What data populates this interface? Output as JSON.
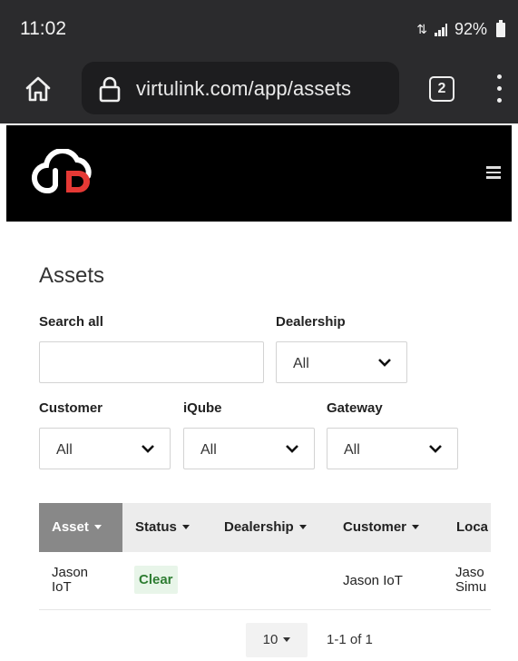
{
  "statusbar": {
    "time": "11:02",
    "battery": "92%"
  },
  "browser": {
    "url": "virtulink.com/app/assets",
    "tab_count": "2"
  },
  "page": {
    "title": "Assets"
  },
  "filters": {
    "search_label": "Search all",
    "search_value": "",
    "dealership_label": "Dealership",
    "dealership_value": "All",
    "customer_label": "Customer",
    "customer_value": "All",
    "iqube_label": "iQube",
    "iqube_value": "All",
    "gateway_label": "Gateway",
    "gateway_value": "All"
  },
  "table": {
    "columns": [
      "Asset",
      "Status",
      "Dealership",
      "Customer",
      "Loca"
    ],
    "rows": [
      {
        "asset": [
          "Jason",
          "IoT"
        ],
        "status": "Clear",
        "dealership": "",
        "customer": "Jason IoT",
        "location": [
          "Jaso",
          "Simu"
        ]
      }
    ]
  },
  "pagination": {
    "page_size": "10",
    "range": "1-1 of 1"
  },
  "colors": {
    "brand_red": "#e53935",
    "header_bg": "#000000",
    "active_header": "#888888",
    "status_clear_bg": "#e8f5e9",
    "status_clear_text": "#2e7d32"
  }
}
